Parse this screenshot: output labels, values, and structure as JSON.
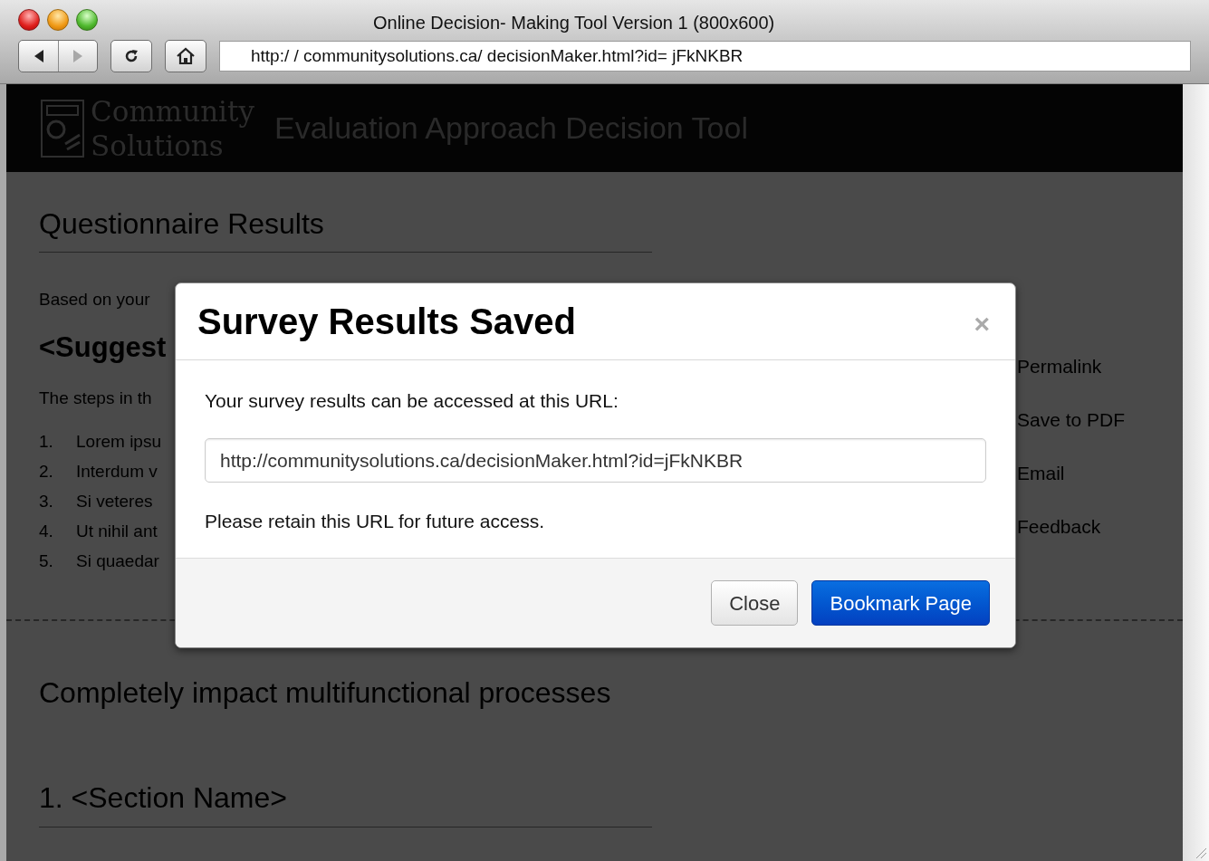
{
  "window": {
    "title": "Online Decision- Making Tool Version 1 (800x600)",
    "address": "http:/ / communitysolutions.ca/ decisionMaker.html?id= jFkNKBR"
  },
  "nav_buttons": [
    {
      "kind": "back",
      "disabled": false
    },
    {
      "kind": "forward",
      "disabled": true
    }
  ],
  "header": {
    "logo_line_1": "Community",
    "logo_line_2": "Solutions",
    "title": "Evaluation Approach Decision Tool"
  },
  "page": {
    "heading": "Questionnaire Results",
    "intro": "Based on your",
    "suggestion": "<Suggest",
    "steps_intro": "The steps in th",
    "steps": [
      {
        "number": "1.",
        "text": "Lorem ipsu"
      },
      {
        "number": "2.",
        "text": "Interdum v"
      },
      {
        "number": "3.",
        "text": "Si veteres"
      },
      {
        "number": "4.",
        "text": "Ut nihil ant"
      },
      {
        "number": "5.",
        "text": "Si quaedar"
      }
    ],
    "section_title": "Completely impact multifunctional processes",
    "section_heading": "1. <Section Name>"
  },
  "sidebar": {
    "links": [
      "Permalink",
      "Save to PDF",
      "Email",
      "Feedback"
    ]
  },
  "modal": {
    "title": "Survey Results Saved",
    "close": "×",
    "message": "Your survey results can be accessed at this URL:",
    "url_value": "http://communitysolutions.ca/decisionMaker.html?id=jFkNKBR",
    "note": "Please retain this URL for future access.",
    "buttons": [
      {
        "label": "Close",
        "kind": "default"
      },
      {
        "label": "Bookmark Page",
        "kind": "primary"
      }
    ]
  }
}
